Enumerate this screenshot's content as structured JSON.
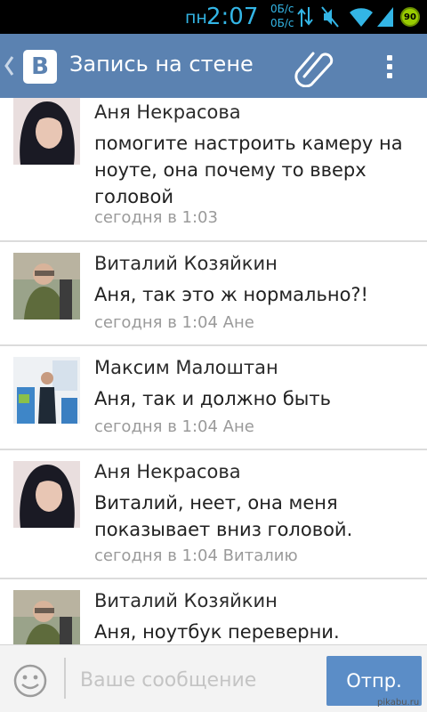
{
  "status_bar": {
    "day": "пн",
    "time": "2:07",
    "net_up": "0Б/с",
    "net_down": "0Б/с",
    "battery": "90"
  },
  "app_bar": {
    "title": "Запись на стене"
  },
  "comments": [
    {
      "author": "Аня Некрасова",
      "text": "помогите настроить камеру на ноуте, она почему то вверх головой",
      "time": "сегодня в 1:03"
    },
    {
      "author": "Виталий Козяйкин",
      "text": "Аня, так это ж нормально?!",
      "time": "сегодня в 1:04 Ане"
    },
    {
      "author": "Максим Малоштан",
      "text": "Аня, так и должно быть",
      "time": "сегодня в 1:04 Ане"
    },
    {
      "author": "Аня Некрасова",
      "text": "Виталий, неет, она меня показывает вниз головой.",
      "time": "сегодня в 1:04 Виталию"
    },
    {
      "author": "Виталий Козяйкин",
      "text": "Аня, ноутбук переверни.",
      "time": ""
    }
  ],
  "compose": {
    "placeholder": "Ваше сообщение",
    "send_label": "Отпр."
  },
  "watermark": "pikabu.ru"
}
